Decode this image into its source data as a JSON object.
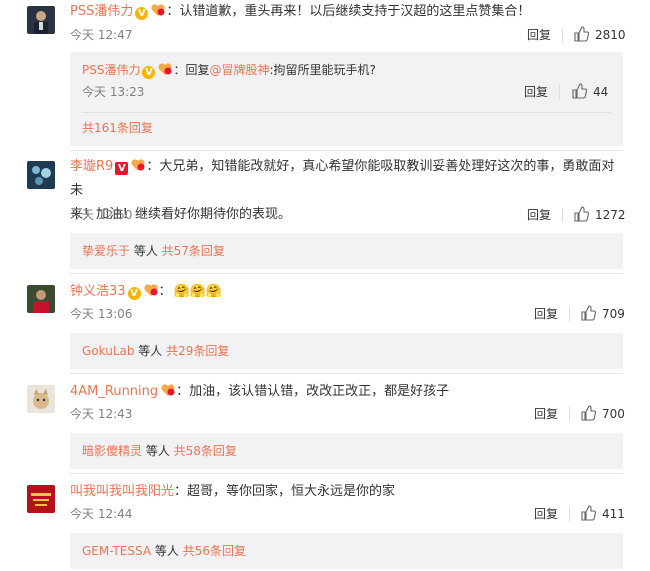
{
  "comments": [
    {
      "user": "PSS潘伟力",
      "text": "：认错道歉，重头再来！以后继续支持于汉超的这里点赞集合！",
      "time": "今天 12:47",
      "reply_label": "回复",
      "likes": "2810",
      "sub_reply": {
        "user": "PSS潘伟力",
        "prefix": "：回复",
        "target": "@冒牌股神",
        "text": ":拘留所里能玩手机?",
        "time": "今天 13:23",
        "reply_label": "回复",
        "likes": "44"
      },
      "more_link": "共161条回复"
    },
    {
      "user": "李璇R9",
      "text_line1": "：大兄弟，知错能改就好，真心希望你能吸取教训妥善处理好这次的事，勇敢面对未",
      "text_line2": "来！加油！继续看好你期待你的表现。",
      "time": "今天 12:50",
      "reply_label": "回复",
      "likes": "1272",
      "summary_user": "挚爱乐于",
      "summary_mid": " 等人 ",
      "summary_link": "共57条回复"
    },
    {
      "user": "钟义浩33",
      "text": "：",
      "emoji": "🤗🤗🤗",
      "time": "今天 13:06",
      "reply_label": "回复",
      "likes": "709",
      "summary_user": "GokuLab",
      "summary_mid": " 等人 ",
      "summary_link": "共29条回复"
    },
    {
      "user": "4AM_Running",
      "text": "：加油，该认错认错，改改正改正，都是好孩子",
      "time": "今天 12:43",
      "reply_label": "回复",
      "likes": "700",
      "summary_user": "暗影傻精灵",
      "summary_mid": " 等人 ",
      "summary_link": "共58条回复"
    },
    {
      "user": "叫我叫我叫我阳光",
      "text": "：超哥，等你回家，恒大永远是你的家",
      "time": "今天 12:44",
      "reply_label": "回复",
      "likes": "411",
      "summary_user": "GEM-TESSA",
      "summary_mid": " 等人 ",
      "summary_link": "共56条回复"
    }
  ],
  "badges": {
    "verified_yellow": "V",
    "verified_red": "V"
  },
  "colors": {
    "link": "#eb7350",
    "subbox_bg": "#f2f2f5",
    "meta": "#808080"
  }
}
